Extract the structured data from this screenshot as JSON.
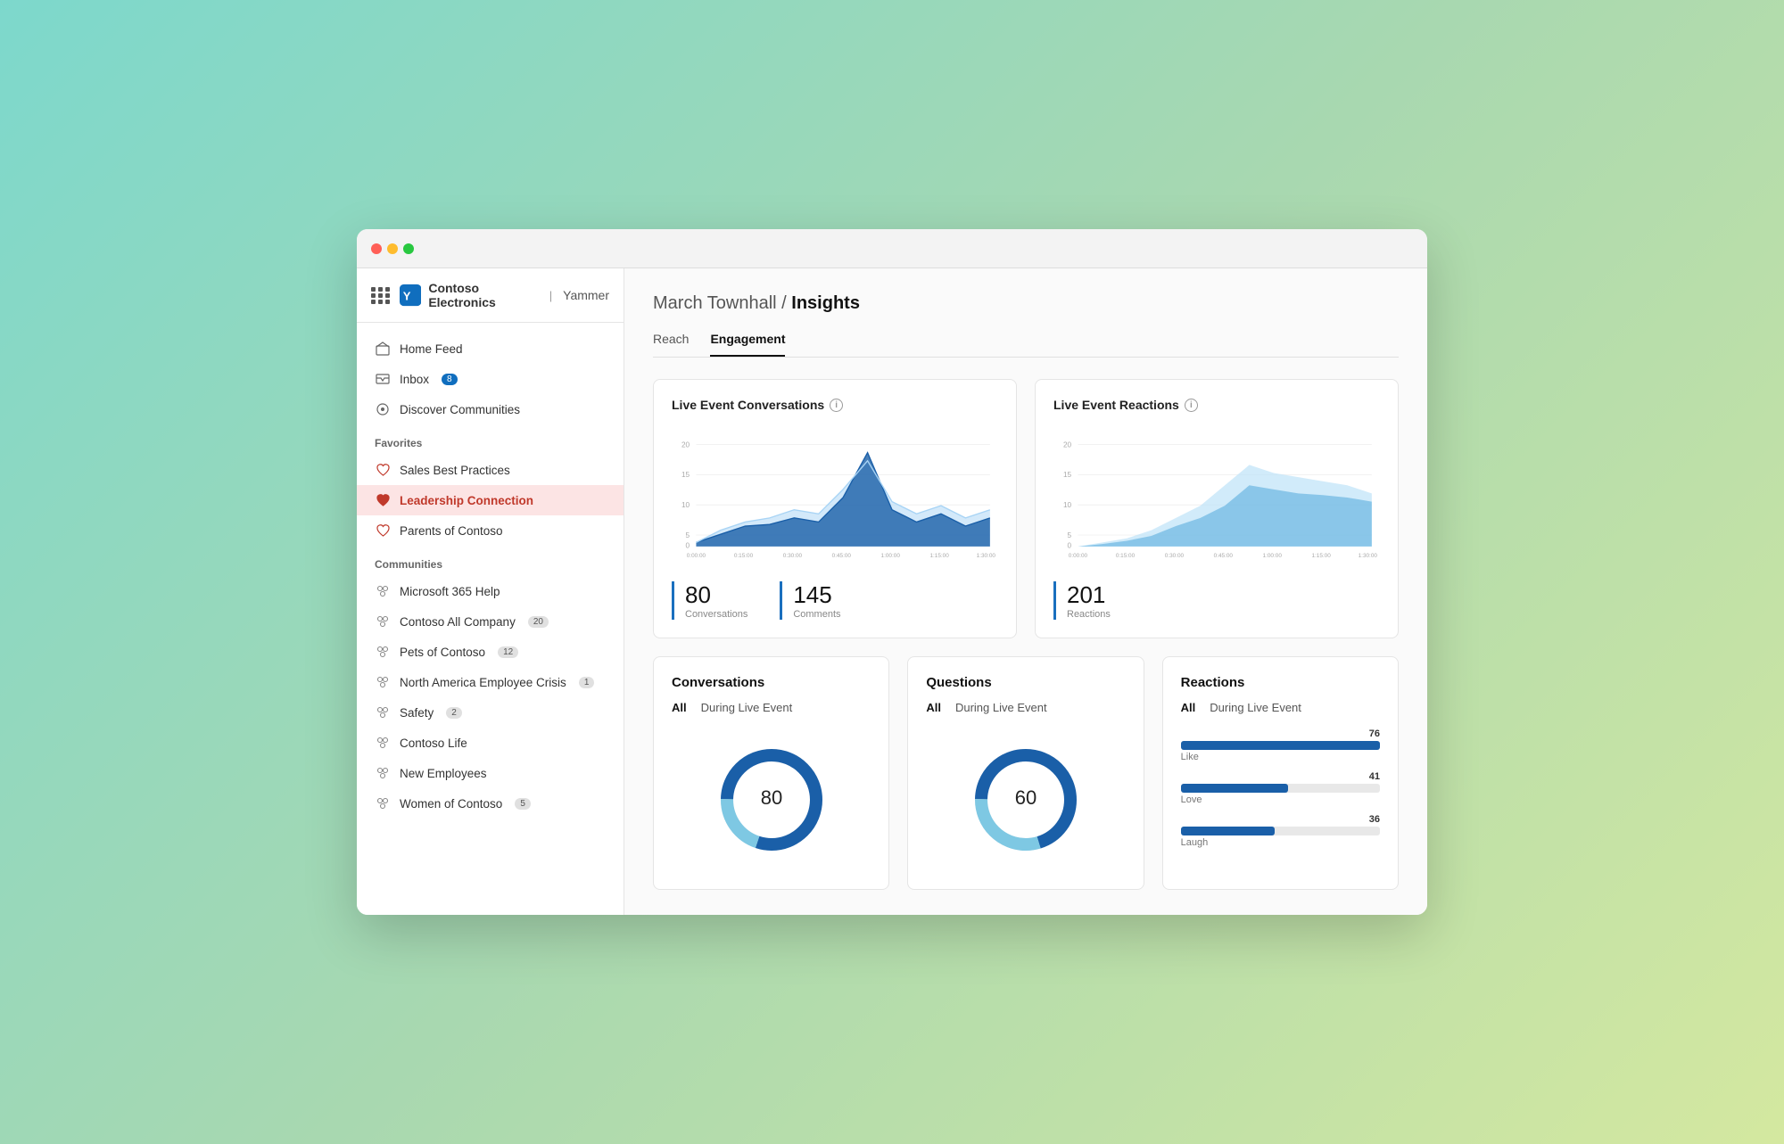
{
  "app": {
    "org": "Contoso Electronics",
    "platform": "Yammer"
  },
  "sidebar": {
    "nav": [
      {
        "id": "home-feed",
        "label": "Home Feed",
        "icon": "home",
        "badge": null
      },
      {
        "id": "inbox",
        "label": "Inbox",
        "icon": "inbox",
        "badge": "8"
      },
      {
        "id": "discover",
        "label": "Discover Communities",
        "icon": "discover",
        "badge": null
      }
    ],
    "sections": [
      {
        "title": "Favorites",
        "items": [
          {
            "id": "sales-best-practices",
            "label": "Sales Best Practices",
            "icon": "heart",
            "badge": null,
            "active": false
          },
          {
            "id": "leadership-connection",
            "label": "Leadership Connection",
            "icon": "heart-filled",
            "badge": null,
            "active": true
          },
          {
            "id": "parents-of-contoso",
            "label": "Parents of Contoso",
            "icon": "heart",
            "badge": null,
            "active": false
          }
        ]
      },
      {
        "title": "Communities",
        "items": [
          {
            "id": "ms365",
            "label": "Microsoft 365 Help",
            "icon": "community",
            "badge": null,
            "active": false
          },
          {
            "id": "contoso-all",
            "label": "Contoso All Company",
            "icon": "community",
            "badge": "20",
            "active": false
          },
          {
            "id": "pets",
            "label": "Pets of Contoso",
            "icon": "community",
            "badge": "12",
            "active": false
          },
          {
            "id": "na-employee-crisis",
            "label": "North America Employee Crisis",
            "icon": "community",
            "badge": "1",
            "active": false
          },
          {
            "id": "safety",
            "label": "Safety",
            "icon": "community",
            "badge": "2",
            "active": false
          },
          {
            "id": "contoso-life",
            "label": "Contoso Life",
            "icon": "community",
            "badge": null,
            "active": false
          },
          {
            "id": "new-employees",
            "label": "New Employees",
            "icon": "community",
            "badge": null,
            "active": false
          },
          {
            "id": "women-of-contoso",
            "label": "Women of Contoso",
            "icon": "community",
            "badge": "5",
            "active": false
          }
        ]
      }
    ]
  },
  "main": {
    "breadcrumb_base": "March Townhall",
    "breadcrumb_current": "Insights",
    "tabs": [
      {
        "id": "reach",
        "label": "Reach",
        "active": false
      },
      {
        "id": "engagement",
        "label": "Engagement",
        "active": true
      }
    ],
    "charts": {
      "conversations": {
        "title": "Live Event Conversations",
        "stat1": {
          "number": "80",
          "label": "Conversations"
        },
        "stat2": {
          "number": "145",
          "label": "Comments"
        }
      },
      "reactions": {
        "title": "Live Event Reactions",
        "stat1": {
          "number": "201",
          "label": "Reactions"
        }
      }
    },
    "bottom_cards": {
      "conversations_card": {
        "title": "Conversations",
        "filters": [
          "All",
          "During Live Event"
        ],
        "active_filter": "All",
        "donut_center": "80"
      },
      "questions_card": {
        "title": "Questions",
        "filters": [
          "All",
          "During Live Event"
        ],
        "active_filter": "All",
        "donut_center": "60"
      },
      "reactions_card": {
        "title": "Reactions",
        "filters": [
          "All",
          "During Live Event"
        ],
        "active_filter": "All",
        "bars": [
          {
            "label": "Like",
            "value": 76,
            "max": 76
          },
          {
            "label": "Love",
            "value": 41,
            "max": 76
          },
          {
            "label": "Laugh",
            "value": 36,
            "max": 76
          }
        ]
      }
    },
    "x_axis_labels": [
      "0:00:00",
      "0:15:00",
      "0:30:00",
      "0:45:00",
      "1:00:00",
      "1:15:00",
      "1:30:00"
    ],
    "y_axis_labels": [
      "0",
      "5",
      "10",
      "15",
      "20"
    ]
  }
}
